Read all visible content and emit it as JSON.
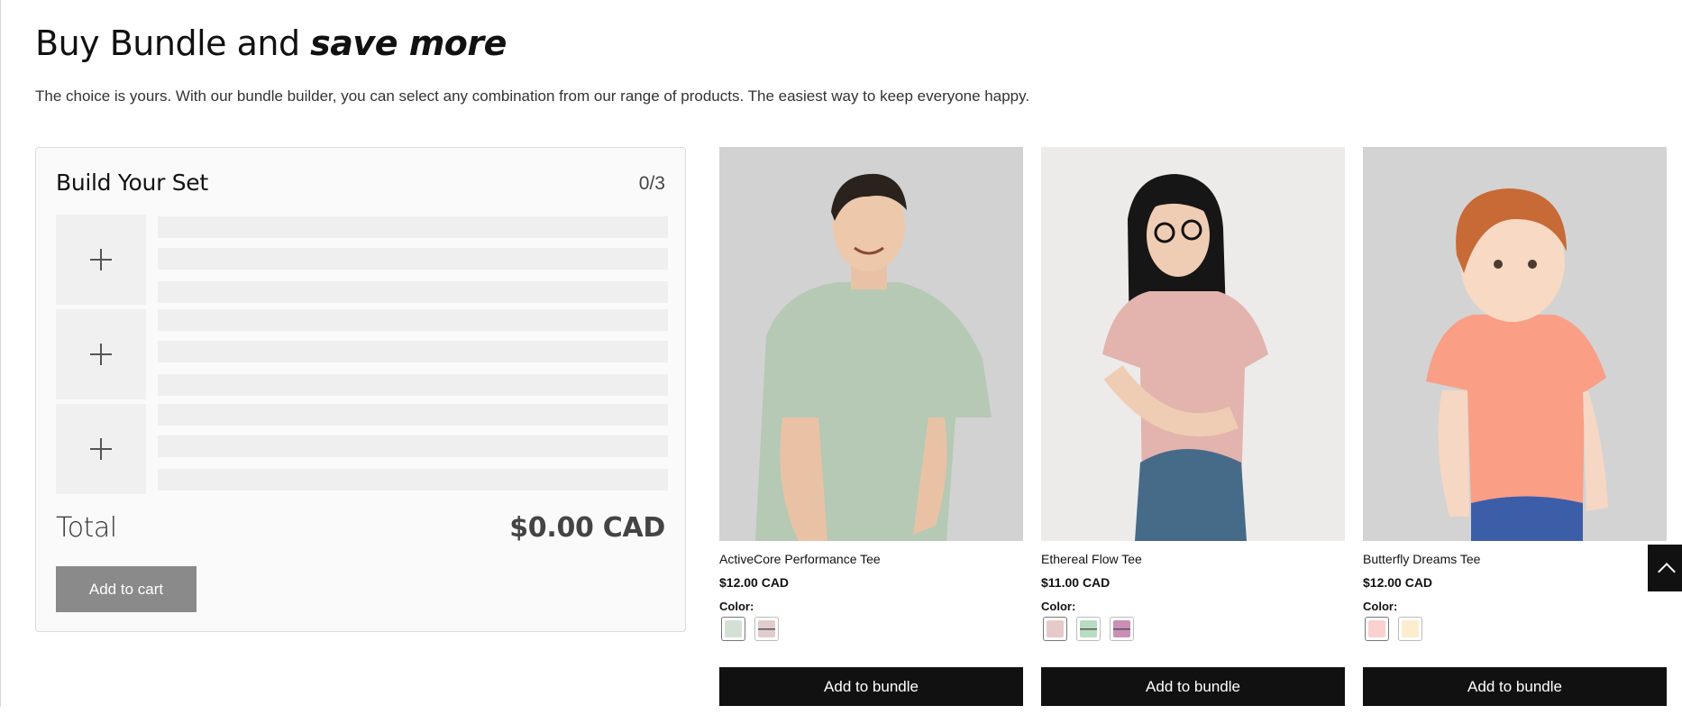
{
  "header": {
    "title_prefix": "Buy Bundle and ",
    "title_emphasis": "save more",
    "subtitle": "The choice is yours. With our bundle builder, you can select any combination from our range of products. The easiest way to keep everyone happy."
  },
  "bundle_panel": {
    "title": "Build Your Set",
    "count": "0/3",
    "slots": [
      {
        "icon": "plus-icon"
      },
      {
        "icon": "plus-icon"
      },
      {
        "icon": "plus-icon"
      }
    ],
    "total_label": "Total",
    "total_value": "$0.00 CAD",
    "add_to_cart_label": "Add to cart"
  },
  "products": [
    {
      "name": "ActiveCore Performance Tee",
      "price": "$12.00 CAD",
      "color_label": "Color:",
      "button_label": "Add to bundle",
      "swatches": [
        "#d4e0d4",
        "#e1cccc"
      ],
      "image_bg": "#d2d2d2",
      "shirt_color": "#b5c9b5"
    },
    {
      "name": "Ethereal Flow Tee",
      "price": "$11.00 CAD",
      "color_label": "Color:",
      "button_label": "Add to bundle",
      "swatches": [
        "#e8c9c9",
        "#b9dbc1",
        "#c98fb7"
      ],
      "image_bg": "#ecebea",
      "shirt_color": "#e3b3ad"
    },
    {
      "name": "Butterfly Dreams Tee",
      "price": "$12.00 CAD",
      "color_label": "Color:",
      "button_label": "Add to bundle",
      "swatches": [
        "#fbd0d0",
        "#fbedcd"
      ],
      "image_bg": "#d3d3d3",
      "shirt_color": "#fa9e86"
    }
  ],
  "scroll_top_icon": "chevron-up-icon"
}
